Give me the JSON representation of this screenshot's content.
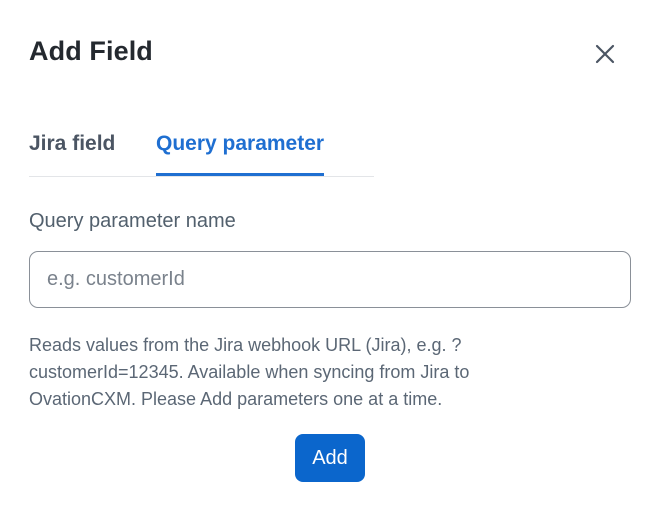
{
  "dialog": {
    "title": "Add Field",
    "close_icon": "close-icon"
  },
  "tabs": [
    {
      "label": "Jira field",
      "active": false
    },
    {
      "label": "Query parameter",
      "active": true
    }
  ],
  "form": {
    "field_label": "Query parameter name",
    "input_placeholder": "e.g. customerId",
    "input_value": "",
    "help_text": "Reads values from the Jira webhook URL (Jira), e.g. ?customerId=12345. Available when syncing from Jira to OvationCXM. Please Add parameters one at a time.",
    "submit_label": "Add"
  },
  "colors": {
    "accent": "#1f6fd1",
    "button": "#0b66cc",
    "title_text": "#24292f",
    "muted_text": "#5b6775"
  }
}
